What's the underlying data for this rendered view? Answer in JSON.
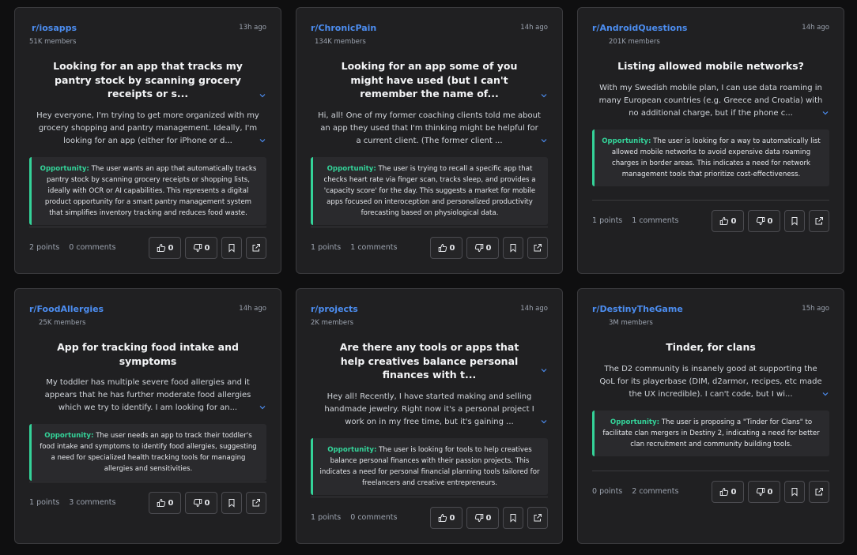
{
  "posts": [
    {
      "subreddit": "r/iosapps",
      "members": "51K members",
      "time": "13h ago",
      "title": "Looking for an app that tracks my pantry stock by scanning grocery receipts or s...",
      "body": "Hey everyone, I'm trying to get more organized with my grocery shopping and pantry management. Ideally, I'm looking for an app (either for iPhone or d...",
      "opportunity_label": "Opportunity:",
      "opportunity": "The user wants an app that automatically tracks pantry stock by scanning grocery receipts or shopping lists, ideally with OCR or AI capabilities. This represents a digital product opportunity for a smart pantry management system that simplifies inventory tracking and reduces food waste.",
      "points": "2 points",
      "comments": "0 comments",
      "upvotes": "0",
      "downvotes": "0"
    },
    {
      "subreddit": "r/ChronicPain",
      "members": "134K members",
      "time": "14h ago",
      "title": "Looking for an app some of you might have used (but I can't remember the name of...",
      "body": "Hi, all! One of my former coaching clients told me about an app they used that I'm thinking might be helpful for a current client. (The former client ...",
      "opportunity_label": "Opportunity:",
      "opportunity": "The user is trying to recall a specific app that checks heart rate via finger scan, tracks sleep, and provides a 'capacity score' for the day. This suggests a market for mobile apps focused on interoception and personalized productivity forecasting based on physiological data.",
      "points": "1 points",
      "comments": "1 comments",
      "upvotes": "0",
      "downvotes": "0"
    },
    {
      "subreddit": "r/AndroidQuestions",
      "members": "201K members",
      "time": "14h ago",
      "title": "Listing allowed mobile networks?",
      "body": "With my Swedish mobile plan, I can use data roaming in many European countries (e.g. Greece and Croatia) with no additional charge, but if the phone c...",
      "opportunity_label": "Opportunity:",
      "opportunity": "The user is looking for a way to automatically list allowed mobile networks to avoid expensive data roaming charges in border areas. This indicates a need for network management tools that prioritize cost-effectiveness.",
      "points": "1 points",
      "comments": "1 comments",
      "upvotes": "0",
      "downvotes": "0"
    },
    {
      "subreddit": "r/FoodAllergies",
      "members": "25K members",
      "time": "14h ago",
      "title": "App for tracking food intake and symptoms",
      "body": "My toddler has multiple severe food allergies and it appears that he has further moderate food allergies which we try to identify. I am looking for an...",
      "opportunity_label": "Opportunity:",
      "opportunity": "The user needs an app to track their toddler's food intake and symptoms to identify food allergies, suggesting a need for specialized health tracking tools for managing allergies and sensitivities.",
      "points": "1 points",
      "comments": "3 comments",
      "upvotes": "0",
      "downvotes": "0"
    },
    {
      "subreddit": "r/projects",
      "members": "2K members",
      "time": "14h ago",
      "title": "Are there any tools or apps that help creatives balance personal finances with t...",
      "body": "Hey all! Recently, I have started making and selling handmade jewelry. Right now it's a personal project I work on in my free time, but it's gaining ...",
      "opportunity_label": "Opportunity:",
      "opportunity": "The user is looking for tools to help creatives balance personal finances with their passion projects. This indicates a need for personal financial planning tools tailored for freelancers and creative entrepreneurs.",
      "points": "1 points",
      "comments": "0 comments",
      "upvotes": "0",
      "downvotes": "0"
    },
    {
      "subreddit": "r/DestinyTheGame",
      "members": "3M members",
      "time": "15h ago",
      "title": "Tinder, for clans",
      "body": "The D2 community is insanely good at supporting the QoL for its playerbase (DIM, d2armor, recipes, etc made the UX incredible). I can't code, but I wi...",
      "opportunity_label": "Opportunity:",
      "opportunity": "The user is proposing a \"Tinder for Clans\" to facilitate clan mergers in Destiny 2, indicating a need for better clan recruitment and community building tools.",
      "points": "0 points",
      "comments": "2 comments",
      "upvotes": "0",
      "downvotes": "0"
    }
  ]
}
